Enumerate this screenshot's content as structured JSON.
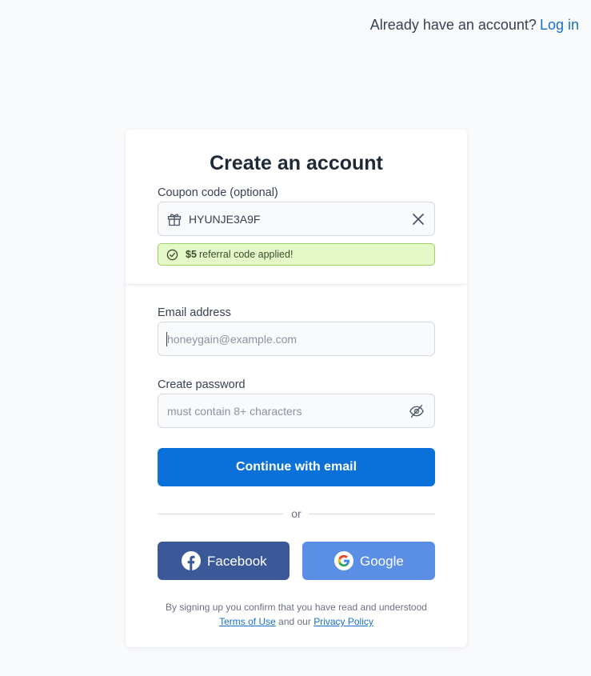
{
  "header": {
    "prompt_text": "Already have an account?",
    "login_link": "Log in"
  },
  "card": {
    "title": "Create an account",
    "coupon": {
      "label": "Coupon code (optional)",
      "value": "HYUNJE3A9F",
      "icon": "gift-icon",
      "clear_icon": "close-icon"
    },
    "referral_alert": {
      "amount": "$5",
      "message": "referral code applied!",
      "icon": "check-circle-icon",
      "color_bg": "#e5f8c8",
      "color_border": "#9fd163"
    },
    "email": {
      "label": "Email address",
      "placeholder": "honeygain@example.com"
    },
    "password": {
      "label": "Create password",
      "placeholder": "must contain 8+ characters",
      "icon": "eye-off-icon"
    },
    "continue_button": "Continue with email",
    "divider_text": "or",
    "social": {
      "facebook_label": "Facebook",
      "google_label": "Google"
    },
    "legal": {
      "prefix": "By signing up you confirm that you have read and understood",
      "terms_link": "Terms of Use",
      "middle": "and our",
      "privacy_link": "Privacy Policy"
    }
  },
  "colors": {
    "primary": "#0b71d9",
    "facebook": "#3b5998",
    "google": "#5b8fe6",
    "link": "#1a6fc9"
  }
}
